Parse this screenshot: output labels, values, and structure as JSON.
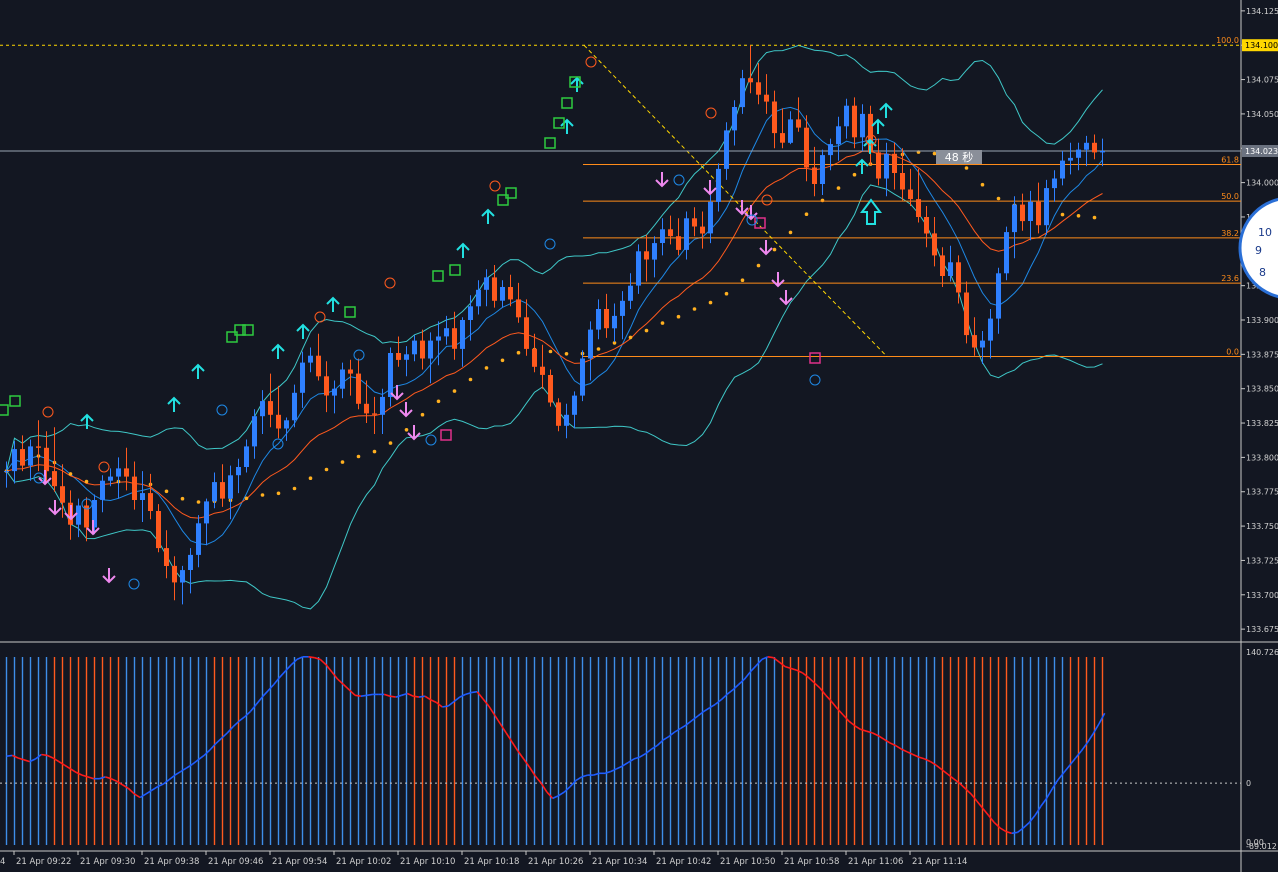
{
  "colors": {
    "background": "#131722",
    "axis": "#d0d0d0",
    "bull": "#2f80ff",
    "bear": "#ff5a1e",
    "bollinger": "#3fc7c7",
    "ma_fast": "#1e88e5",
    "ma_slow": "#ff5a1e",
    "ma_dots": "#ffb020",
    "fib": "#ff8c1a",
    "fib_trend": "#ffd700",
    "high_line": "#ffd700",
    "price_line": "#9aa4b2",
    "arrow_up": "#22e0e0",
    "arrow_down": "#ee88ee",
    "osc_up": "#1e5cff",
    "osc_down": "#ff1a1a",
    "hist_blue": "#3e8ee8",
    "hist_orange": "#ff5a1e"
  },
  "countdown_label": "48 秒",
  "price_axis": {
    "labels": [
      "134.125",
      "134.100",
      "134.075",
      "134.050",
      "134.025",
      "134.000",
      "133.975",
      "133.950",
      "133.925",
      "133.900",
      "133.875",
      "133.850",
      "133.825",
      "133.800",
      "133.775",
      "133.750",
      "133.725",
      "133.700",
      "133.675"
    ],
    "high_label": "134.100",
    "last_label": "134.023"
  },
  "osc_axis": {
    "top_label": "140.726",
    "zero_label": "0",
    "bottom_label": "0.00",
    "bottom_label2": "-69.012"
  },
  "time_axis": {
    "labels": [
      "21 Apr 09:22",
      "21 Apr 09:30",
      "21 Apr 09:38",
      "21 Apr 09:46",
      "21 Apr 09:54",
      "21 Apr 10:02",
      "21 Apr 10:10",
      "21 Apr 10:18",
      "21 Apr 10:26",
      "21 Apr 10:34",
      "21 Apr 10:42",
      "21 Apr 10:50",
      "21 Apr 10:58",
      "21 Apr 11:06",
      "21 Apr 11:14"
    ],
    "left_fragment": "4"
  },
  "fib_levels": [
    {
      "label": "100.0",
      "price": 134.1
    },
    {
      "label": "61.8",
      "price": 134.0132
    },
    {
      "label": "50.0",
      "price": 133.9865
    },
    {
      "label": "38.2",
      "price": 133.9598
    },
    {
      "label": "23.6",
      "price": 133.9268
    },
    {
      "label": "0.0",
      "price": 133.8734
    }
  ],
  "chart_data": {
    "type": "candlestick",
    "timeframe_minutes": 1,
    "first_candle_time": "21 Apr 09:14",
    "last_candle_time": "21 Apr 11:14",
    "ylim": [
      133.67,
      134.13
    ],
    "series": [
      {
        "name": "OHLC",
        "type": "candlestick",
        "values": [
          [
            133.79,
            133.797,
            133.778,
            133.79
          ],
          [
            133.79,
            133.812,
            133.781,
            133.806
          ],
          [
            133.806,
            133.816,
            133.79,
            133.794
          ],
          [
            133.794,
            133.813,
            133.783,
            133.808
          ],
          [
            133.808,
            133.827,
            133.79,
            133.807
          ],
          [
            133.807,
            133.819,
            133.782,
            133.79
          ],
          [
            133.79,
            133.822,
            133.775,
            133.779
          ],
          [
            133.779,
            133.795,
            133.756,
            133.767
          ],
          [
            133.767,
            133.776,
            133.74,
            133.751
          ],
          [
            133.751,
            133.77,
            133.742,
            133.765
          ],
          [
            133.765,
            133.771,
            133.739,
            133.749
          ],
          [
            133.749,
            133.773,
            133.744,
            133.769
          ],
          [
            133.769,
            133.787,
            133.76,
            133.783
          ],
          [
            133.783,
            133.792,
            133.779,
            133.786
          ],
          [
            133.786,
            133.8,
            133.77,
            133.792
          ],
          [
            133.792,
            133.807,
            133.776,
            133.786
          ],
          [
            133.786,
            133.797,
            133.762,
            133.769
          ],
          [
            133.769,
            133.79,
            133.753,
            133.774
          ],
          [
            133.774,
            133.788,
            133.755,
            133.761
          ],
          [
            133.761,
            133.766,
            133.731,
            133.734
          ],
          [
            133.734,
            133.747,
            133.712,
            133.721
          ],
          [
            133.721,
            133.728,
            133.696,
            133.709
          ],
          [
            133.709,
            133.721,
            133.693,
            133.718
          ],
          [
            133.718,
            133.734,
            133.701,
            133.729
          ],
          [
            133.729,
            133.758,
            133.72,
            133.752
          ],
          [
            133.752,
            133.77,
            133.736,
            133.768
          ],
          [
            133.768,
            133.789,
            133.763,
            133.782
          ],
          [
            133.782,
            133.795,
            133.764,
            133.77
          ],
          [
            133.77,
            133.794,
            133.755,
            133.787
          ],
          [
            133.787,
            133.799,
            133.774,
            133.793
          ],
          [
            133.793,
            133.813,
            133.789,
            133.808
          ],
          [
            133.808,
            133.835,
            133.799,
            133.83
          ],
          [
            133.83,
            133.849,
            133.817,
            133.841
          ],
          [
            133.841,
            133.861,
            133.822,
            133.831
          ],
          [
            133.831,
            133.852,
            133.814,
            133.821
          ],
          [
            133.821,
            133.829,
            133.812,
            133.827
          ],
          [
            133.827,
            133.853,
            133.822,
            133.847
          ],
          [
            133.847,
            133.877,
            133.836,
            133.869
          ],
          [
            133.869,
            133.88,
            133.862,
            133.874
          ],
          [
            133.874,
            133.89,
            133.856,
            133.859
          ],
          [
            133.859,
            133.87,
            133.833,
            133.845
          ],
          [
            133.845,
            133.856,
            133.832,
            133.85
          ],
          [
            133.85,
            133.869,
            133.843,
            133.864
          ],
          [
            133.864,
            133.871,
            133.845,
            133.861
          ],
          [
            133.861,
            133.872,
            133.835,
            133.839
          ],
          [
            133.839,
            133.856,
            133.825,
            133.832
          ],
          [
            133.832,
            133.844,
            133.817,
            133.831
          ],
          [
            133.831,
            133.85,
            133.817,
            133.844
          ],
          [
            133.844,
            133.88,
            133.837,
            133.876
          ],
          [
            133.876,
            133.888,
            133.866,
            133.871
          ],
          [
            133.871,
            133.881,
            133.859,
            133.875
          ],
          [
            133.875,
            133.889,
            133.87,
            133.885
          ],
          [
            133.885,
            133.893,
            133.864,
            133.872
          ],
          [
            133.872,
            133.891,
            133.854,
            133.885
          ],
          [
            133.885,
            133.899,
            133.867,
            133.888
          ],
          [
            133.888,
            133.903,
            133.882,
            133.894
          ],
          [
            133.894,
            133.906,
            133.871,
            133.879
          ],
          [
            133.879,
            133.902,
            133.866,
            133.9
          ],
          [
            133.9,
            133.918,
            133.885,
            133.91
          ],
          [
            133.91,
            133.929,
            133.904,
            133.922
          ],
          [
            133.922,
            133.937,
            133.91,
            133.931
          ],
          [
            133.931,
            133.94,
            133.909,
            133.914
          ],
          [
            133.914,
            133.929,
            133.909,
            133.924
          ],
          [
            133.924,
            133.933,
            133.91,
            133.915
          ],
          [
            133.915,
            133.927,
            133.898,
            133.902
          ],
          [
            133.902,
            133.915,
            133.874,
            133.879
          ],
          [
            133.879,
            133.89,
            133.862,
            133.866
          ],
          [
            133.866,
            133.882,
            133.85,
            133.86
          ],
          [
            133.86,
            133.864,
            133.837,
            133.84
          ],
          [
            133.84,
            133.843,
            133.819,
            133.823
          ],
          [
            133.823,
            133.839,
            133.814,
            133.831
          ],
          [
            133.831,
            133.848,
            133.821,
            133.845
          ],
          [
            133.845,
            133.878,
            133.841,
            133.872
          ],
          [
            133.872,
            133.899,
            133.856,
            133.893
          ],
          [
            133.893,
            133.915,
            133.886,
            133.908
          ],
          [
            133.908,
            133.919,
            133.887,
            133.894
          ],
          [
            133.894,
            133.912,
            133.884,
            133.903
          ],
          [
            133.903,
            133.921,
            133.886,
            133.914
          ],
          [
            133.914,
            133.934,
            133.908,
            133.925
          ],
          [
            133.925,
            133.955,
            133.919,
            133.95
          ],
          [
            133.95,
            133.962,
            133.928,
            133.944
          ],
          [
            133.944,
            133.961,
            133.931,
            133.956
          ],
          [
            133.956,
            133.974,
            133.947,
            133.966
          ],
          [
            133.966,
            133.976,
            133.955,
            133.961
          ],
          [
            133.961,
            133.974,
            133.947,
            133.951
          ],
          [
            133.951,
            133.979,
            133.944,
            133.974
          ],
          [
            133.974,
            133.982,
            133.961,
            133.968
          ],
          [
            133.968,
            133.979,
            133.952,
            133.963
          ],
          [
            133.963,
            133.991,
            133.956,
            133.986
          ],
          [
            133.986,
            134.014,
            133.979,
            134.01
          ],
          [
            134.01,
            134.044,
            134.002,
            134.038
          ],
          [
            134.038,
            134.06,
            134.027,
            134.055
          ],
          [
            134.055,
            134.082,
            134.05,
            134.076
          ],
          [
            134.076,
            134.1,
            134.065,
            134.073
          ],
          [
            134.073,
            134.087,
            134.057,
            134.064
          ],
          [
            134.064,
            134.079,
            134.05,
            134.059
          ],
          [
            134.059,
            134.067,
            134.025,
            134.036
          ],
          [
            134.036,
            134.054,
            134.025,
            134.029
          ],
          [
            134.029,
            134.052,
            134.028,
            134.046
          ],
          [
            134.046,
            134.062,
            134.037,
            134.04
          ],
          [
            134.04,
            134.049,
            134.001,
            134.011
          ],
          [
            134.011,
            134.026,
            133.99,
            133.999
          ],
          [
            133.999,
            134.024,
            133.991,
            134.02
          ],
          [
            134.02,
            134.032,
            134.009,
            134.028
          ],
          [
            134.028,
            134.048,
            134.016,
            134.041
          ],
          [
            134.041,
            134.061,
            134.032,
            134.056
          ],
          [
            134.056,
            134.062,
            134.025,
            134.033
          ],
          [
            134.033,
            134.057,
            134.023,
            134.05
          ],
          [
            134.05,
            134.056,
            134.013,
            134.022
          ],
          [
            134.022,
            134.032,
            133.998,
            134.003
          ],
          [
            134.003,
            134.029,
            133.99,
            134.021
          ],
          [
            134.021,
            134.029,
            133.995,
            134.007
          ],
          [
            134.007,
            134.025,
            133.987,
            133.995
          ],
          [
            133.995,
            134.01,
            133.983,
            133.988
          ],
          [
            133.988,
            134.01,
            133.971,
            133.975
          ],
          [
            133.975,
            133.983,
            133.953,
            133.963
          ],
          [
            133.963,
            133.975,
            133.939,
            133.947
          ],
          [
            133.947,
            133.953,
            133.924,
            133.932
          ],
          [
            133.932,
            133.954,
            133.928,
            133.942
          ],
          [
            133.942,
            133.947,
            133.912,
            133.92
          ],
          [
            133.92,
            133.928,
            133.883,
            133.889
          ],
          [
            133.889,
            133.902,
            133.874,
            133.88
          ],
          [
            133.88,
            133.892,
            133.868,
            133.885
          ],
          [
            133.885,
            133.908,
            133.872,
            133.901
          ],
          [
            133.901,
            133.938,
            133.89,
            133.934
          ],
          [
            133.934,
            133.968,
            133.929,
            133.964
          ],
          [
            133.964,
            133.99,
            133.945,
            133.984
          ],
          [
            133.984,
            133.992,
            133.965,
            133.972
          ],
          [
            133.972,
            133.994,
            133.958,
            133.986
          ],
          [
            133.986,
            134.0,
            133.963,
            133.969
          ],
          [
            133.969,
            134.002,
            133.962,
            133.996
          ],
          [
            133.996,
            134.009,
            133.986,
            134.003
          ],
          [
            134.003,
            134.023,
            133.998,
            134.016
          ],
          [
            134.016,
            134.029,
            134.006,
            134.018
          ],
          [
            134.018,
            134.029,
            134.009,
            134.024
          ],
          [
            134.024,
            134.034,
            134.012,
            134.029
          ],
          [
            134.029,
            134.035,
            134.017,
            134.022
          ],
          [
            134.022,
            134.032,
            134.012,
            134.023
          ]
        ]
      },
      {
        "name": "Oscillator",
        "type": "line",
        "values": [
          30,
          31,
          28,
          26,
          24,
          27,
          32,
          31,
          28,
          24,
          20,
          16,
          12,
          9,
          7,
          5,
          5,
          7,
          5,
          2,
          -2,
          -6,
          -12,
          -16,
          -12,
          -8,
          -4,
          -1,
          4,
          9,
          13,
          17,
          21,
          26,
          31,
          37,
          44,
          50,
          56,
          63,
          69,
          74,
          80,
          88,
          96,
          103,
          110,
          118,
          125,
          132,
          138,
          141,
          141,
          140,
          138,
          132,
          124,
          116,
          110,
          104,
          98,
          97,
          98,
          99,
          99,
          99,
          97,
          96,
          98,
          100,
          97,
          96,
          97,
          93,
          90,
          85,
          86,
          91,
          96,
          99,
          101,
          102,
          94,
          86,
          76,
          66,
          56,
          46,
          36,
          27,
          18,
          8,
          0,
          -10,
          -17,
          -14,
          -10,
          -4,
          3,
          7,
          9,
          9,
          11,
          11,
          13,
          16,
          19,
          23,
          27,
          29,
          33,
          38,
          42,
          48,
          52,
          57,
          61,
          65,
          70,
          75,
          80,
          84,
          88,
          93,
          99,
          104,
          110,
          116,
          124,
          131,
          138,
          141,
          140,
          135,
          130,
          128,
          126,
          123,
          118,
          112,
          106,
          98,
          91,
          83,
          76,
          69,
          64,
          60,
          58,
          56,
          53,
          49,
          45,
          42,
          38,
          35,
          32,
          29,
          27,
          24,
          20,
          15,
          10,
          5,
          0,
          -6,
          -12,
          -20,
          -28,
          -36,
          -44,
          -50,
          -54,
          -56,
          -55,
          -50,
          -44,
          -36,
          -26,
          -17,
          -6,
          4,
          12,
          20,
          28,
          36,
          45,
          55,
          66,
          78
        ]
      }
    ]
  }
}
